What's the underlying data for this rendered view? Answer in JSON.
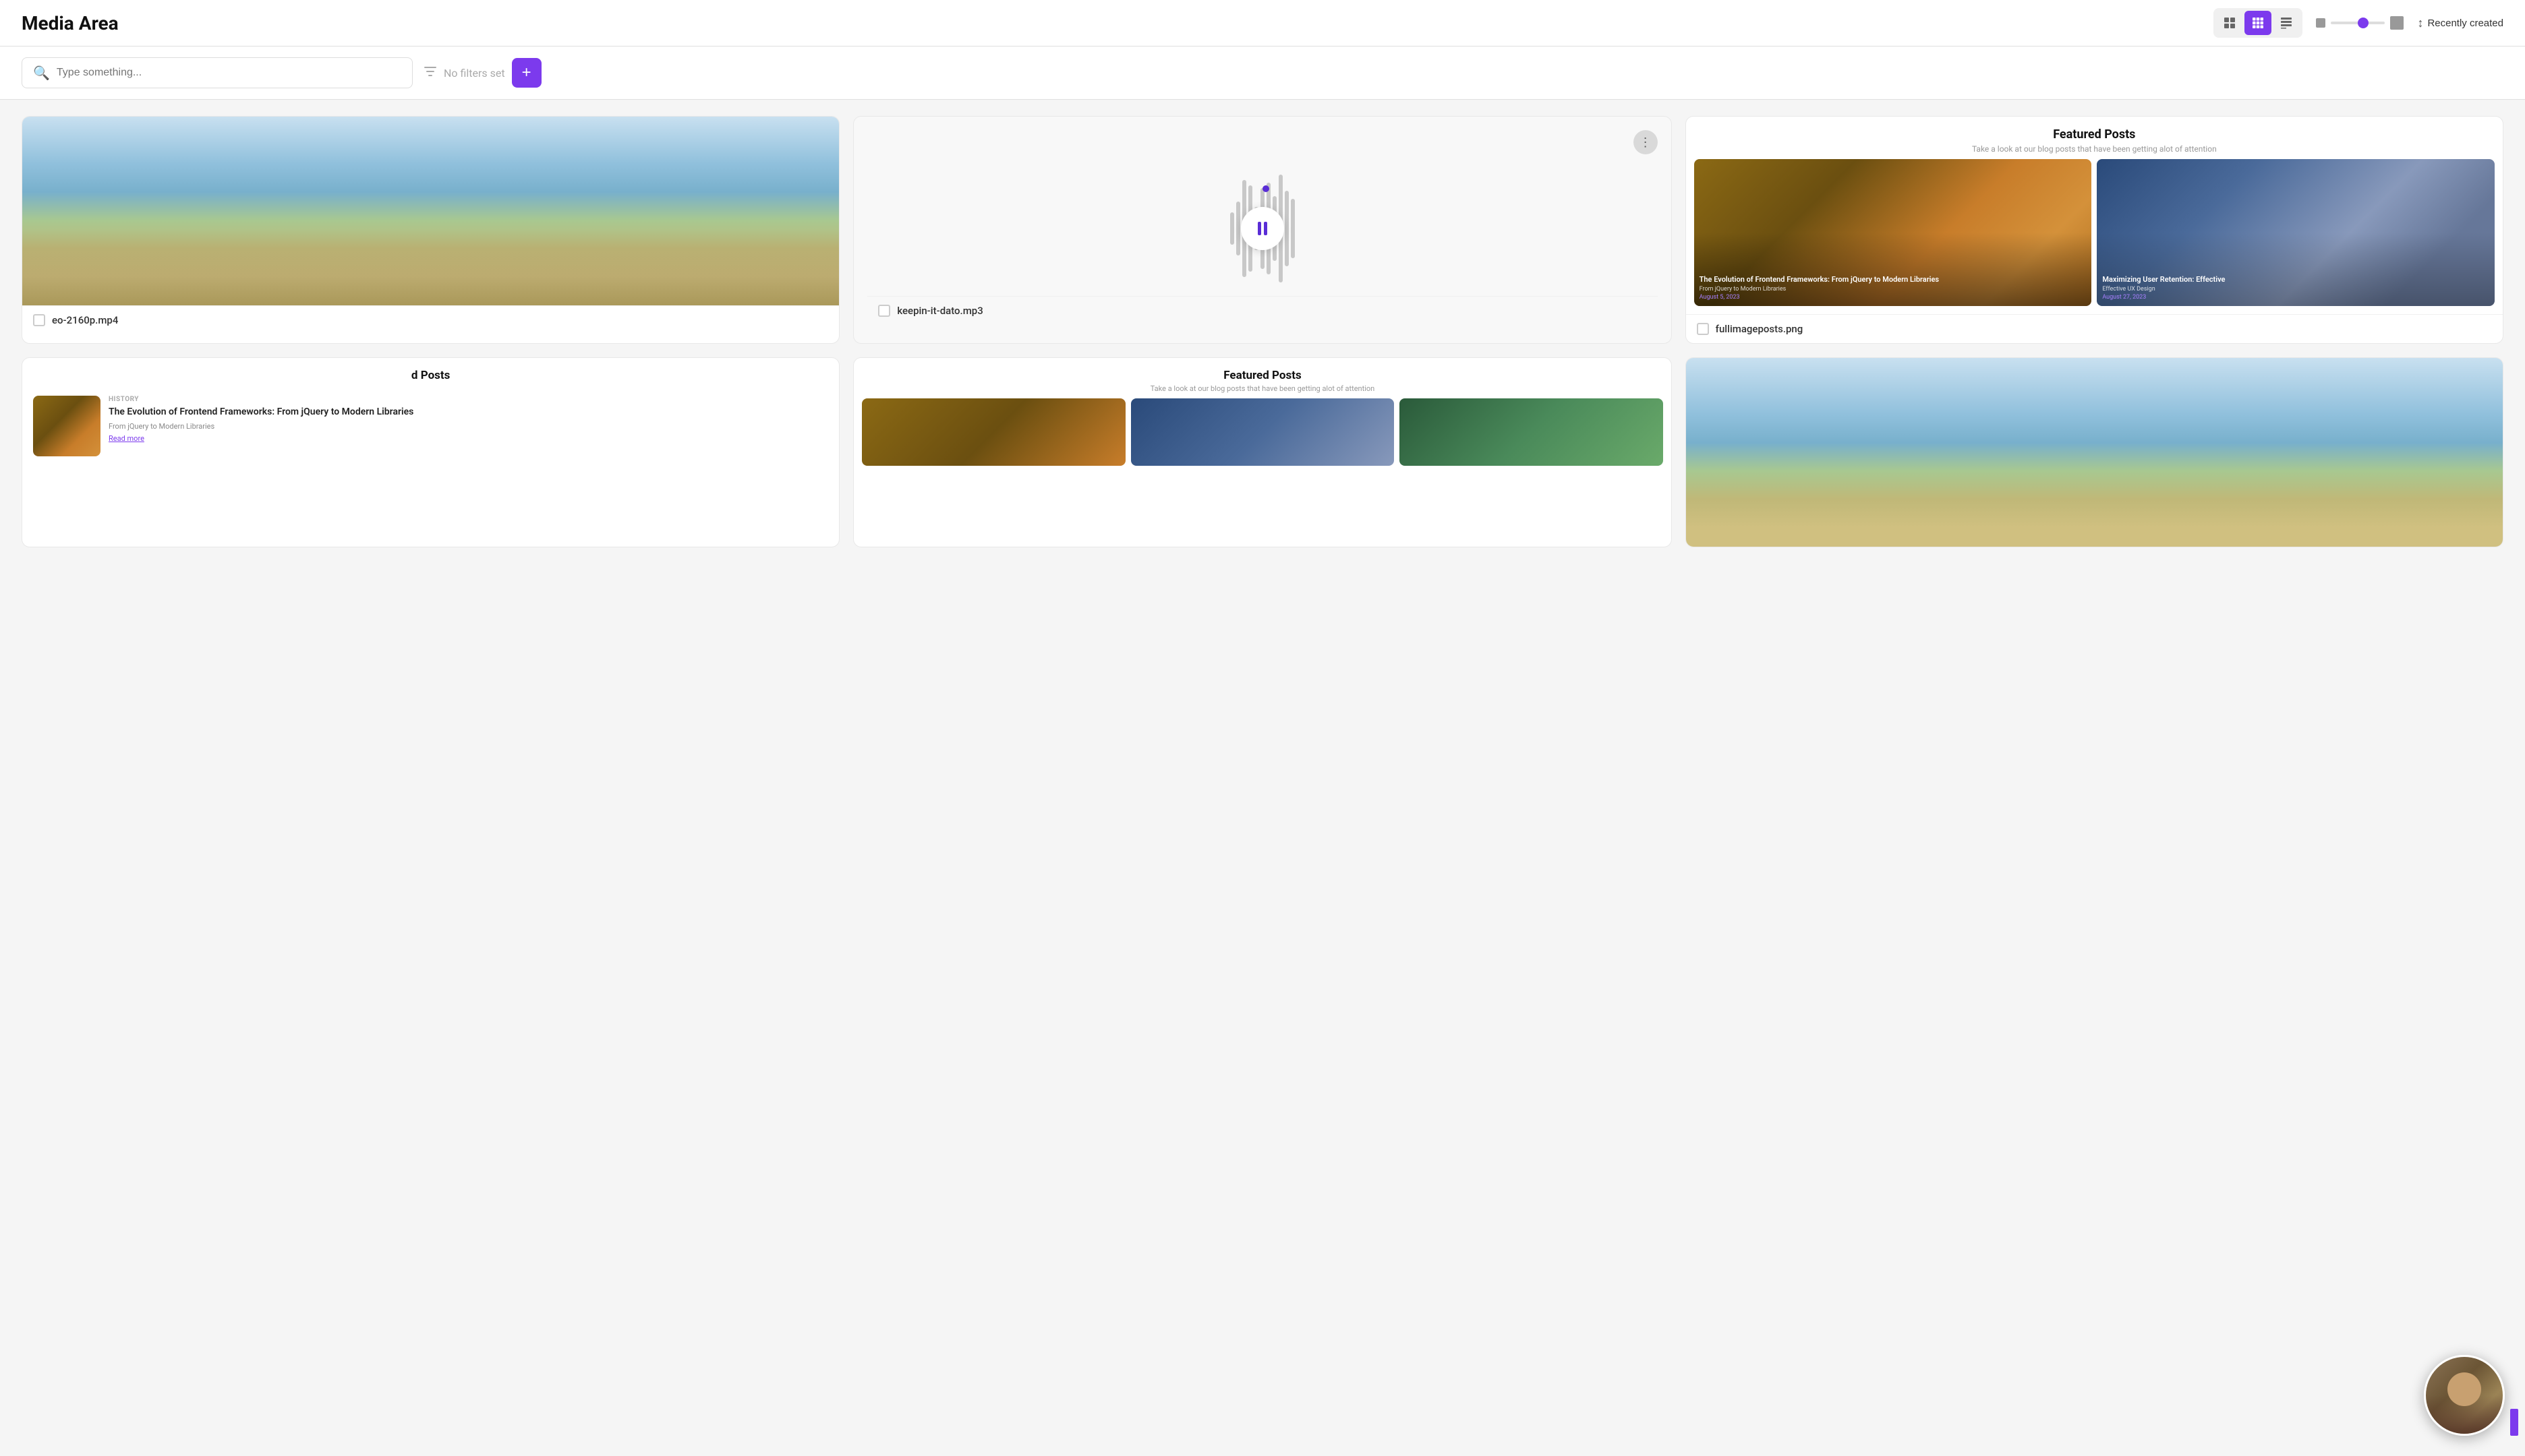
{
  "header": {
    "title": "Media Area",
    "sort_label": "Recently created",
    "view_modes": [
      {
        "id": "grid2",
        "label": "Grid 2",
        "icon": "⊞"
      },
      {
        "id": "grid3",
        "label": "Grid 3",
        "icon": "⊟",
        "active": true
      },
      {
        "id": "table",
        "label": "Table",
        "icon": "⊟"
      }
    ]
  },
  "search": {
    "placeholder": "Type something...",
    "filter_label": "No filters set",
    "add_label": "+"
  },
  "cards": [
    {
      "id": "beach-video",
      "type": "video",
      "label": "eo-2160p.mp4"
    },
    {
      "id": "audio",
      "type": "audio",
      "label": "keepin-it-dato.mp3"
    },
    {
      "id": "featured-posts-img",
      "type": "image",
      "label": "fullimageposts.png",
      "title": "Featured Posts",
      "subtitle": "Take a look at our blog posts that have been getting alot of attention",
      "post1_title": "The Evolution of Frontend Frameworks: From jQuery to Modern Libraries",
      "post1_source": "From jQuery to Modern Libraries",
      "post1_date": "August 5, 2023",
      "post2_title": "Maximizing User Retention: Effective",
      "post2_source": "Effective UX Design",
      "post2_date": "August 27, 2023"
    }
  ],
  "bottom_cards": [
    {
      "id": "bottom-featured-left",
      "type": "featured",
      "title": "d Posts",
      "subtitle": "",
      "history_tag": "HISTORY",
      "blog_title": "The Evolution of Frontend Frameworks: From jQuery to Modern Libraries",
      "blog_source": "From jQuery to Modern Libraries",
      "read_more": "Read more"
    },
    {
      "id": "bottom-featured-center",
      "type": "featured-full",
      "title": "Featured Posts",
      "subtitle": "Take a look at our blog posts that have been getting alot of attention"
    },
    {
      "id": "bottom-video",
      "type": "video-thumb"
    }
  ],
  "pip": {
    "visible": true
  }
}
